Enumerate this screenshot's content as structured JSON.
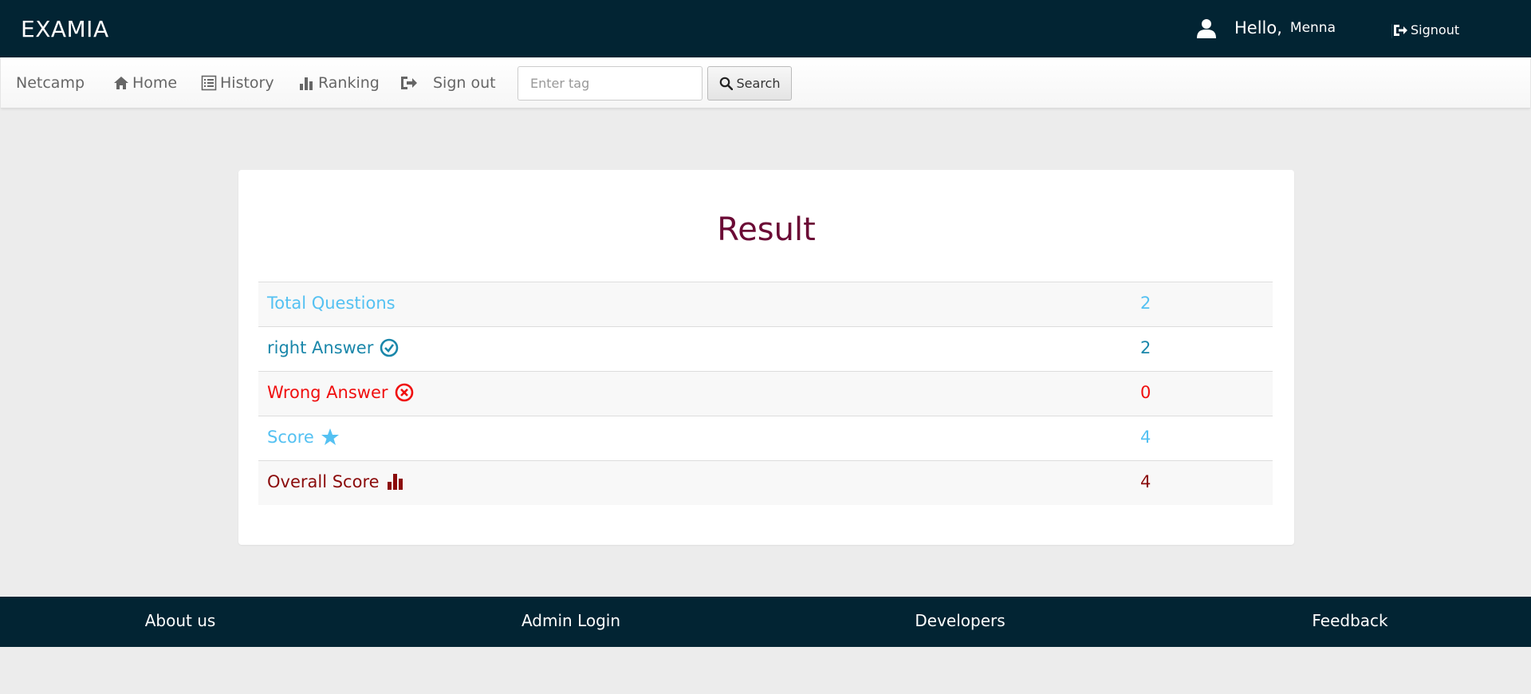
{
  "header": {
    "brand": "EXAMIA",
    "hello": "Hello,",
    "username": "Menna",
    "signout": "Signout"
  },
  "nav": {
    "brand": "Netcamp",
    "home": "Home",
    "history": "History",
    "ranking": "Ranking",
    "signout": "Sign out",
    "search_placeholder": "Enter tag",
    "search_button": "Search"
  },
  "result": {
    "title": "Result",
    "rows": [
      {
        "label": "Total Questions",
        "value": "2",
        "color": "#54c1f2"
      },
      {
        "label": "right Answer",
        "value": "2",
        "color": "#1a87aa",
        "icon": "check-circle-icon"
      },
      {
        "label": "Wrong Answer",
        "value": "0",
        "color": "#f00e0e",
        "icon": "x-circle-icon"
      },
      {
        "label": "Score",
        "value": "4",
        "color": "#54c1f2",
        "icon": "star-icon"
      },
      {
        "label": "Overall Score",
        "value": "4",
        "color": "#8b0b0b",
        "icon": "bar-chart-icon"
      }
    ]
  },
  "footer": {
    "about": "About us",
    "admin": "Admin Login",
    "developers": "Developers",
    "feedback": "Feedback"
  },
  "colors": {
    "header_bg": "#022433",
    "title": "#6b0a35"
  }
}
